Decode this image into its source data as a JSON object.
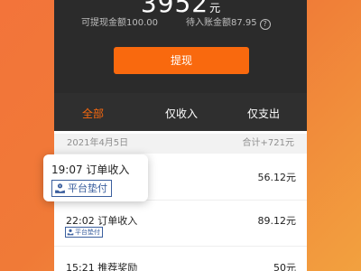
{
  "summary": {
    "balance": "3952",
    "balance_unit": "元",
    "withdrawable_label": "可提现金额100.00",
    "pending_label": "待入账金额87.95",
    "help_icon": "?",
    "withdraw_button": "提现"
  },
  "tabs": [
    {
      "label": "全部",
      "active": true
    },
    {
      "label": "仅收入",
      "active": false
    },
    {
      "label": "仅支出",
      "active": false
    }
  ],
  "date_group": {
    "date": "2021年4月5日",
    "total": "合计+721元"
  },
  "transactions": [
    {
      "time_title": "19:07  订单收入",
      "amount": "56.12元",
      "badge": "平台垫付"
    },
    {
      "time_title": "22:02  订单收入",
      "amount": "89.12元",
      "badge": "平台垫付"
    },
    {
      "time_title": "15:21  推荐奖励",
      "amount": "50元"
    }
  ],
  "colors": {
    "accent": "#f9690e",
    "header_bg": "#2b2b2b",
    "badge": "#3b5f9e"
  }
}
